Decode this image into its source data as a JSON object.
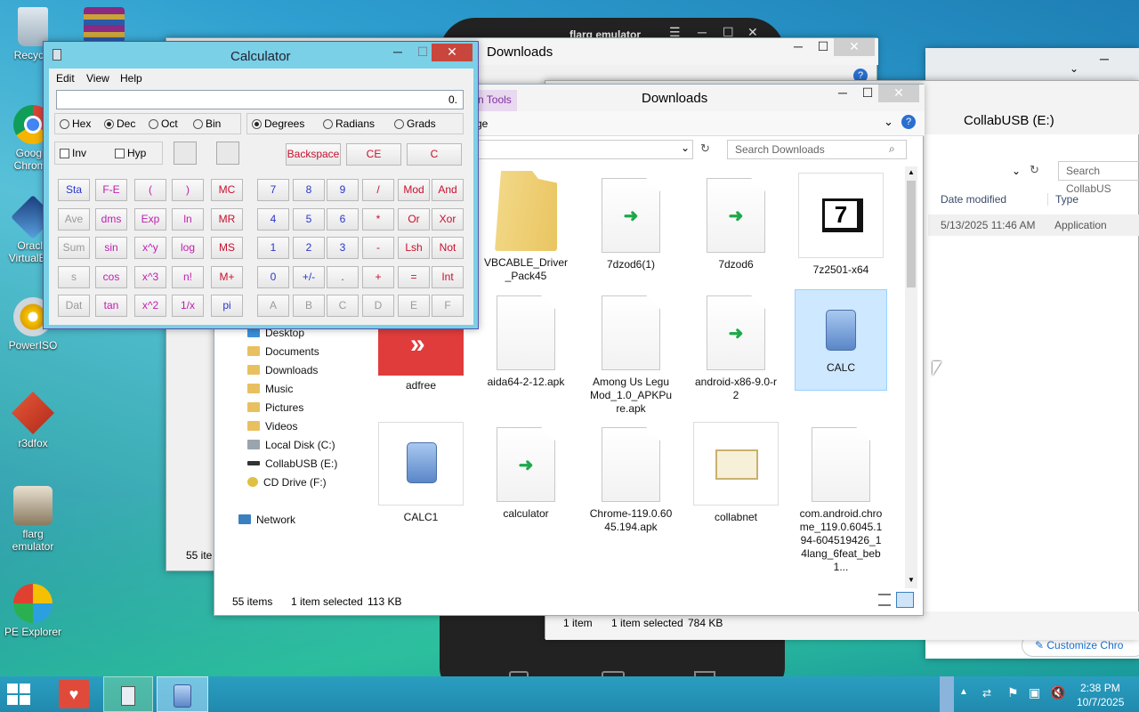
{
  "desktop_icons": [
    {
      "label": "Recycle",
      "icon": "recycle-bin-icon"
    },
    {
      "label": "Google Chrome",
      "icon": "chrome-icon"
    },
    {
      "label": "Oracle VirtualBox",
      "icon": "virtualbox-icon"
    },
    {
      "label": "PowerISO",
      "icon": "poweriso-icon"
    },
    {
      "label": "r3dfox",
      "icon": "r3dfox-icon"
    },
    {
      "label": "flarg emulator",
      "icon": "flarg-icon"
    },
    {
      "label": "PE Explorer",
      "icon": "pe-explorer-icon"
    }
  ],
  "emulator": {
    "title": "flarg emulator"
  },
  "calc": {
    "title": "Calculator",
    "menu": [
      "Edit",
      "View",
      "Help"
    ],
    "display": "0.",
    "bases": [
      "Hex",
      "Dec",
      "Oct",
      "Bin"
    ],
    "angles": [
      "Degrees",
      "Radians",
      "Grads"
    ],
    "checks": [
      "Inv",
      "Hyp"
    ],
    "top_buttons": [
      "Backspace",
      "CE",
      "C"
    ],
    "rows": [
      [
        "Sta",
        "F-E",
        "(",
        ")",
        "MC",
        "7",
        "8",
        "9",
        "/",
        "Mod",
        "And"
      ],
      [
        "Ave",
        "dms",
        "Exp",
        "ln",
        "MR",
        "4",
        "5",
        "6",
        "*",
        "Or",
        "Xor"
      ],
      [
        "Sum",
        "sin",
        "x^y",
        "log",
        "MS",
        "1",
        "2",
        "3",
        "-",
        "Lsh",
        "Not"
      ],
      [
        "s",
        "cos",
        "x^3",
        "n!",
        "M+",
        "0",
        "+/-",
        ".",
        "+",
        "=",
        "Int"
      ],
      [
        "Dat",
        "tan",
        "x^2",
        "1/x",
        "pi",
        "A",
        "B",
        "C",
        "D",
        "E",
        "F"
      ]
    ]
  },
  "explorer_back": {
    "title": "Downloads",
    "status_count": "55 ite"
  },
  "explorer_front": {
    "title": "Downloads",
    "ribbon_tab": "n Tools",
    "address_tail": "ge",
    "search_placeholder": "Search Downloads",
    "nav": [
      "Desktop",
      "Documents",
      "Downloads",
      "Music",
      "Pictures",
      "Videos",
      "Local Disk (C:)",
      "CollabUSB (E:)",
      "CD Drive (F:)",
      "Network"
    ],
    "files": [
      "VBCABLE_Driver_Pack45",
      "7dzod6(1)",
      "7dzod6",
      "7z2501-x64",
      "adfree",
      "aida64-2-12.apk",
      "Among Us Legu Mod_1.0_APKPure.apk",
      "android-x86-9.0-r2",
      "CALC",
      "CALC1",
      "calculator",
      "Chrome-119.0.6045.194.apk",
      "collabnet",
      "com.android.chrome_119.0.6045.194-604519426_14lang_6feat_beb1..."
    ],
    "status_items": "55 items",
    "status_selected": "1 item selected",
    "status_size": "113 KB"
  },
  "explorer_collab": {
    "title": "CollabUSB (E:)",
    "search_placeholder": "Search CollabUS",
    "col_date": "Date modified",
    "col_type": "Type",
    "row_date": "5/13/2025 11:46 AM",
    "row_type": "Application",
    "status_items": "1 item",
    "status_selected": "1 item selected",
    "status_size": "784 KB"
  },
  "chrome_bg": {
    "customize": "Customize Chro"
  },
  "taskbar": {
    "time": "2:38 PM",
    "date": "10/7/2025"
  }
}
